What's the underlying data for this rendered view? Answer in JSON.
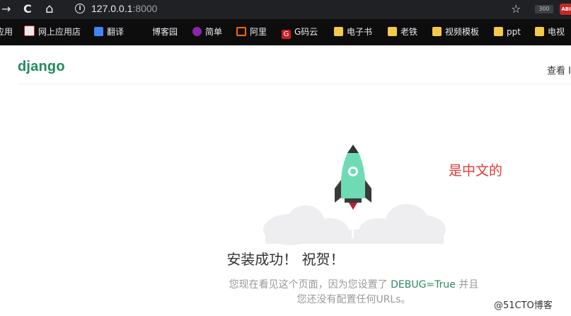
{
  "browser": {
    "back_glyph": "→",
    "reload_glyph": "C",
    "home_glyph": "⌂",
    "url_host": "127.0.0.1",
    "url_port": ":8000",
    "star_glyph": "☆",
    "ext1_label": "300",
    "ext2_label": "ABI"
  },
  "bookmarks": [
    {
      "label": "应用",
      "icon": "apps-icon"
    },
    {
      "label": "网上应用店",
      "icon": "webstore-icon"
    },
    {
      "label": "翻译",
      "icon": "translate-icon"
    },
    {
      "label": "博客园",
      "icon": "cnblogs-icon"
    },
    {
      "label": "简单",
      "icon": "jianshu-icon"
    },
    {
      "label": "阿里",
      "icon": "aliyun-icon"
    },
    {
      "label": "G码云",
      "icon": "gitee-icon"
    },
    {
      "label": "电子书",
      "icon": "folder-icon"
    },
    {
      "label": "老铁",
      "icon": "folder-icon"
    },
    {
      "label": "视频模板",
      "icon": "folder-icon"
    },
    {
      "label": "ppt",
      "icon": "folder-icon"
    },
    {
      "label": "电视",
      "icon": "folder-icon"
    }
  ],
  "django": {
    "logo": "django",
    "right_link": "查看 I"
  },
  "annotation": "是中文的",
  "headline": "安装成功！ 祝贺！",
  "sub_line1_pre": "您现在看见这个页面，因为您设置了 ",
  "sub_line1_debug": "DEBUG=True",
  "sub_line1_post": " 并且",
  "sub_line2": "您还没有配置任何URLs。",
  "watermark": "@51CTO博客",
  "colors": {
    "django_green": "#228b5a",
    "rocket_teal": "#6fdbb5",
    "annotation_red": "#e53935"
  }
}
